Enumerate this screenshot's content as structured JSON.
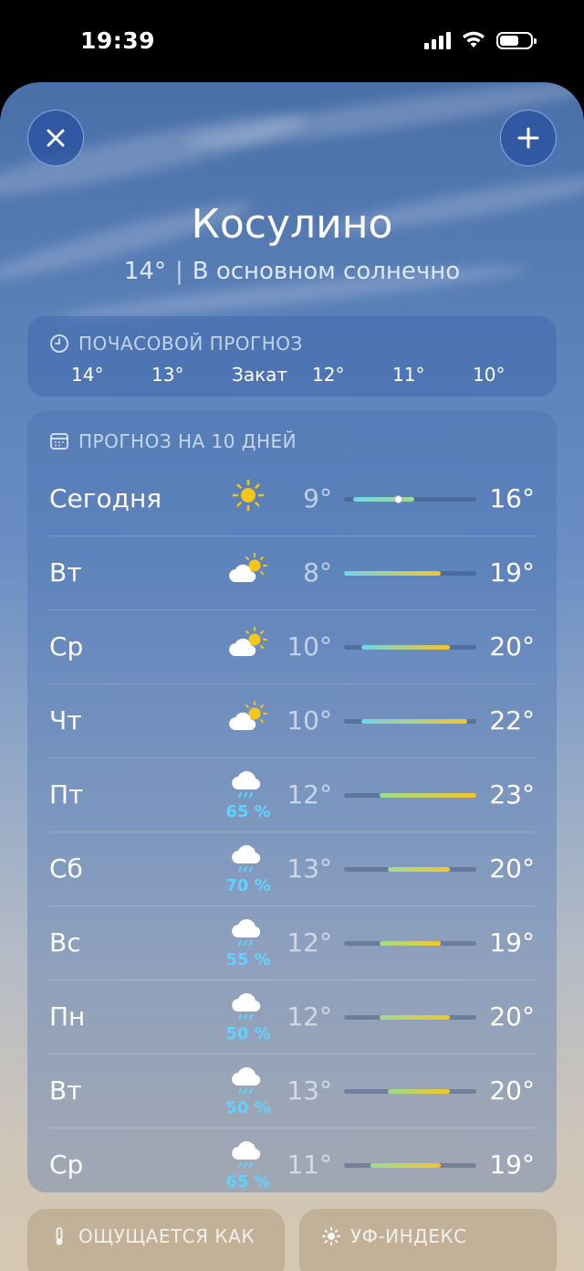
{
  "status": {
    "time": "19:39"
  },
  "header": {
    "city": "Косулино",
    "temp": "14°",
    "condition": "В основном солнечно"
  },
  "hourly": {
    "title": "ПОЧАСОВОЙ ПРОГНОЗ",
    "hours": [
      "14°",
      "13°",
      "Закат",
      "12°",
      "11°",
      "10°"
    ]
  },
  "daily": {
    "title": "ПРОГНОЗ НА 10 ДНЕЙ",
    "range_min": 8,
    "range_max": 23,
    "current_temp": 14,
    "days": [
      {
        "day": "Сегодня",
        "icon": "sun-icon",
        "prob": "",
        "lo": "9°",
        "hi": "16°",
        "lo_v": 9,
        "hi_v": 16
      },
      {
        "day": "Вт",
        "icon": "partly-cloudy-icon",
        "prob": "",
        "lo": "8°",
        "hi": "19°",
        "lo_v": 8,
        "hi_v": 19
      },
      {
        "day": "Ср",
        "icon": "partly-cloudy-icon",
        "prob": "",
        "lo": "10°",
        "hi": "20°",
        "lo_v": 10,
        "hi_v": 20
      },
      {
        "day": "Чт",
        "icon": "partly-cloudy-icon",
        "prob": "",
        "lo": "10°",
        "hi": "22°",
        "lo_v": 10,
        "hi_v": 22
      },
      {
        "day": "Пт",
        "icon": "rain-icon",
        "prob": "65 %",
        "lo": "12°",
        "hi": "23°",
        "lo_v": 12,
        "hi_v": 23
      },
      {
        "day": "Сб",
        "icon": "rain-icon",
        "prob": "70 %",
        "lo": "13°",
        "hi": "20°",
        "lo_v": 13,
        "hi_v": 20
      },
      {
        "day": "Вс",
        "icon": "rain-icon",
        "prob": "55 %",
        "lo": "12°",
        "hi": "19°",
        "lo_v": 12,
        "hi_v": 19
      },
      {
        "day": "Пн",
        "icon": "rain-icon",
        "prob": "50 %",
        "lo": "12°",
        "hi": "20°",
        "lo_v": 12,
        "hi_v": 20
      },
      {
        "day": "Вт",
        "icon": "rain-icon",
        "prob": "50 %",
        "lo": "13°",
        "hi": "20°",
        "lo_v": 13,
        "hi_v": 20
      },
      {
        "day": "Ср",
        "icon": "rain-icon",
        "prob": "65 %",
        "lo": "11°",
        "hi": "19°",
        "lo_v": 11,
        "hi_v": 19
      }
    ]
  },
  "feels_like": {
    "title": "ОЩУЩАЕТСЯ КАК"
  },
  "uv": {
    "title": "УФ-ИНДЕКС"
  },
  "colors": {
    "prob": "#5fd2ff",
    "cool": "#6fd6e8",
    "mild": "#9ddc8f",
    "warm": "#f2c62a"
  }
}
